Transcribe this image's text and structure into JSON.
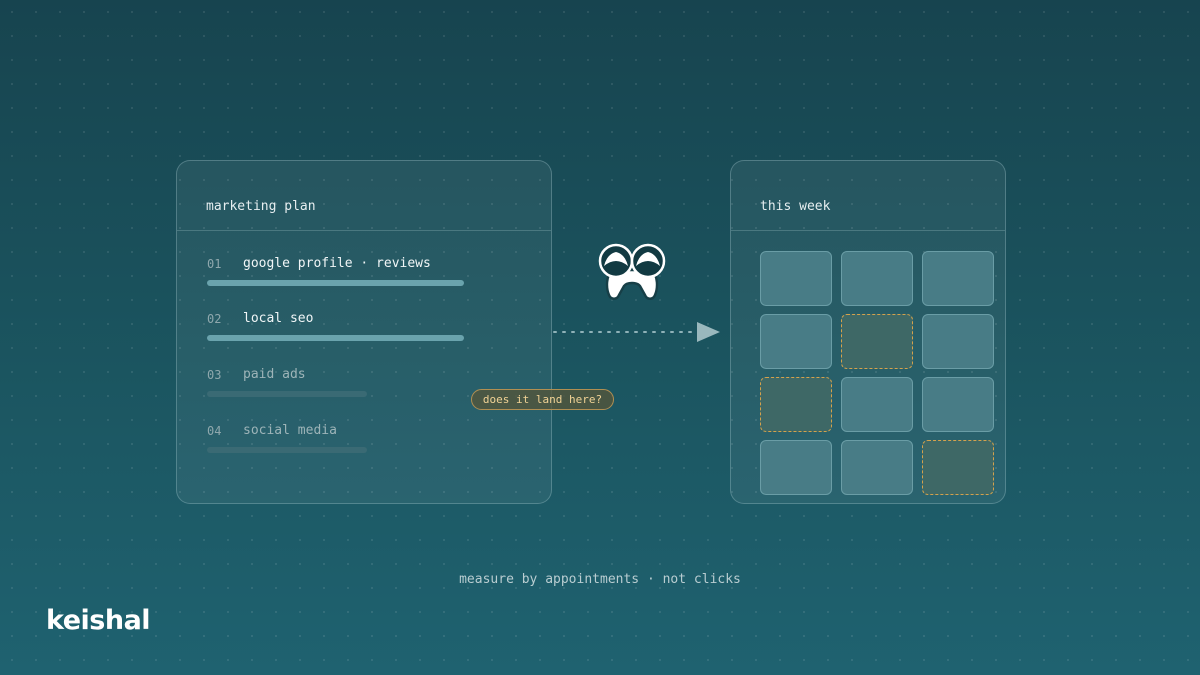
{
  "plan_card": {
    "title": "marketing plan",
    "items": [
      {
        "number": "01",
        "label": "google profile · reviews",
        "state": "active"
      },
      {
        "number": "02",
        "label": "local seo",
        "state": "active"
      },
      {
        "number": "03",
        "label": "paid ads",
        "state": "inactive"
      },
      {
        "number": "04",
        "label": "social media",
        "state": "inactive"
      }
    ]
  },
  "week_card": {
    "title": "this week",
    "grid": {
      "columns": 3,
      "rows": 4,
      "target_slots": [
        "row 2 col 2",
        "row 3 col 1",
        "row 4 col 3"
      ]
    }
  },
  "question_tag": "does it land here?",
  "footer_note": "measure by appointments · not clicks",
  "brand": "keishal",
  "icons": {
    "mascot": "tooth-with-binoculars-icon",
    "connector": "dotted-arrow-right-icon"
  },
  "colors": {
    "accent_bar": "#6aa3ad",
    "dim_bar": "#3a6a74",
    "target_border": "#d4a24c",
    "tag_text": "#f0d295"
  }
}
